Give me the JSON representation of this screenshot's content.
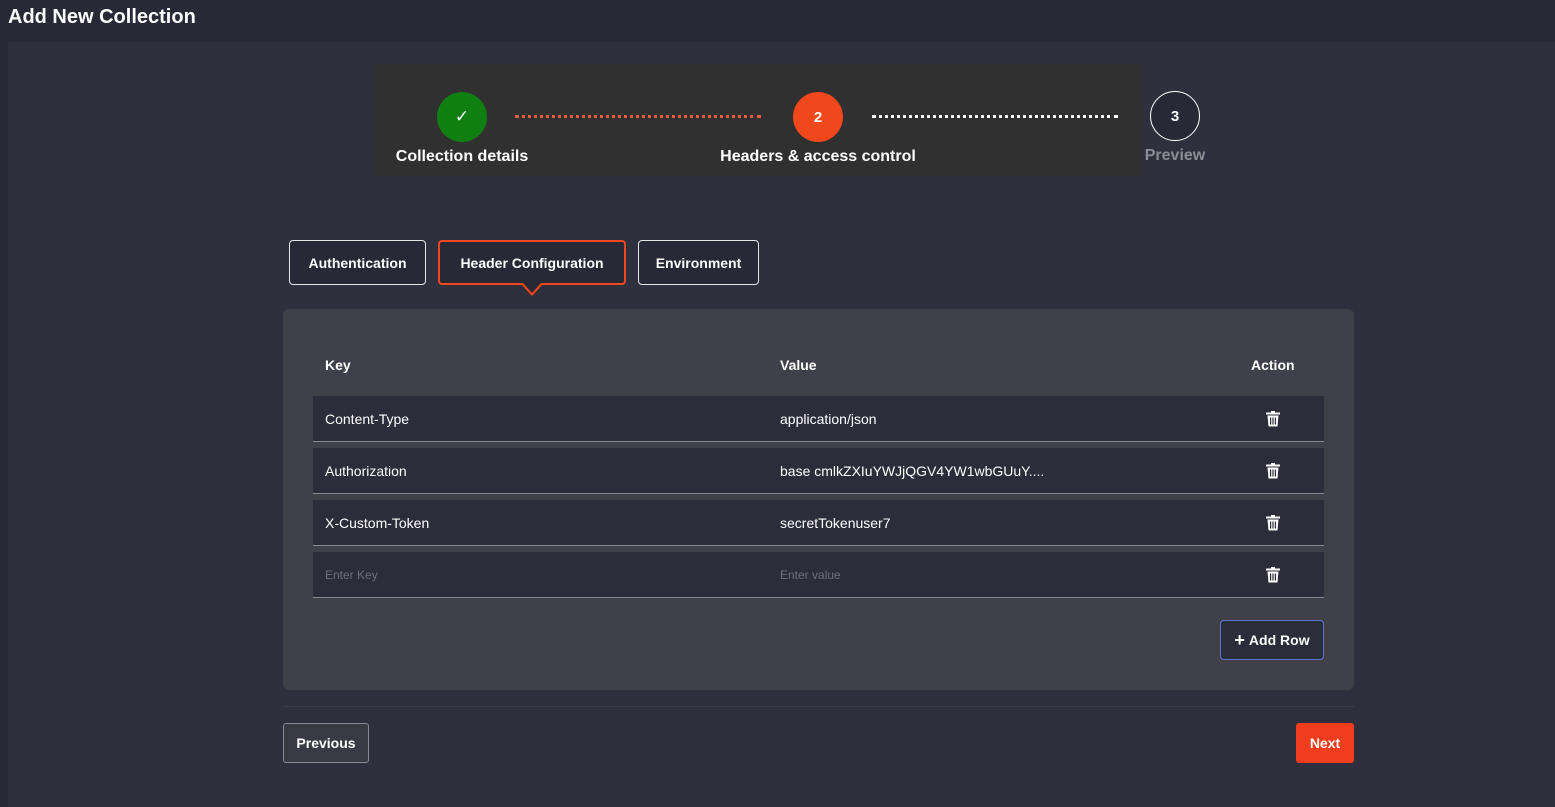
{
  "header": {
    "title": "Add New Collection"
  },
  "stepper": {
    "steps": [
      {
        "marker": "✓",
        "label": "Collection details",
        "state": "completed"
      },
      {
        "marker": "2",
        "label": "Headers & access control",
        "state": "active"
      },
      {
        "marker": "3",
        "label": "Preview",
        "state": "pending"
      }
    ]
  },
  "tabs": [
    {
      "label": "Authentication",
      "active": false
    },
    {
      "label": "Header Configuration",
      "active": true
    },
    {
      "label": "Environment",
      "active": false
    }
  ],
  "table": {
    "columns": {
      "key": "Key",
      "value": "Value",
      "action": "Action"
    },
    "rows": [
      {
        "key": "Content-Type",
        "value": "application/json"
      },
      {
        "key": "Authorization",
        "value": "base cmlkZXIuYWJjQGV4YW1wbGUuY...."
      },
      {
        "key": "X-Custom-Token",
        "value": "secretTokenuser7"
      }
    ],
    "new_row": {
      "key_placeholder": "Enter Key",
      "value_placeholder": "Enter value"
    },
    "action_icon": "trash-icon"
  },
  "buttons": {
    "add_row": "Add Row",
    "previous": "Previous",
    "next": "Next"
  },
  "colors": {
    "accent": "#f1471d",
    "success": "#0f7f12",
    "background": "#282837",
    "panel": "#40404a"
  }
}
